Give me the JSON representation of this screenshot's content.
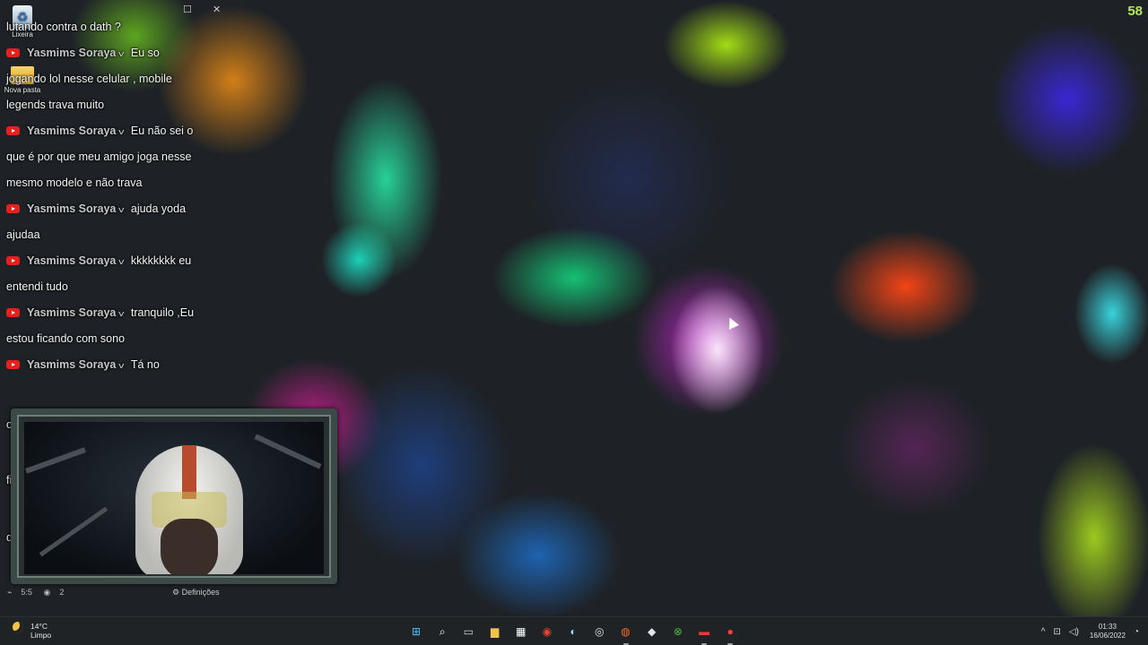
{
  "desktop": {
    "fps_counter": "58",
    "icons": [
      {
        "label": "Lixeira",
        "icon": "recycle-bin-icon"
      },
      {
        "label": "Nova pasta",
        "icon": "folder-icon"
      }
    ],
    "window_controls": {
      "maximize": "☐",
      "close": "✕"
    }
  },
  "chat": {
    "author": "Yasmims Soraya",
    "lines": [
      {
        "type": "text",
        "text": "lutando contra o dath ?"
      },
      {
        "type": "header",
        "message": "Eu so"
      },
      {
        "type": "text",
        "text": "jogando lol nesse celular , mobile"
      },
      {
        "type": "text",
        "text": "legends trava muito"
      },
      {
        "type": "header",
        "message": "Eu não sei o"
      },
      {
        "type": "text",
        "text": "que é por que meu amigo joga nesse"
      },
      {
        "type": "text",
        "text": "mesmo modelo e não trava"
      },
      {
        "type": "header",
        "message": "ajuda yoda"
      },
      {
        "type": "text",
        "text": "ajudaa"
      },
      {
        "type": "header",
        "message": "kkkkkkkk eu"
      },
      {
        "type": "text",
        "text": "entendi tudo"
      },
      {
        "type": "header",
        "message": "tranquilo ,Eu"
      },
      {
        "type": "text",
        "text": "estou ficando com sono"
      },
      {
        "type": "header",
        "message": "Tá no"
      }
    ],
    "clipped_lines": [
      "c",
      "fi",
      "d"
    ]
  },
  "stream_overlay": {
    "stats_left": "5:5",
    "viewers": "2",
    "settings_label": "Definições"
  },
  "taskbar": {
    "weather_temp": "14°C",
    "weather_desc": "Limpo",
    "apps": [
      {
        "name": "windows-start-icon",
        "glyph": "⊞",
        "color": "#4cc2ff"
      },
      {
        "name": "search-icon",
        "glyph": "⌕",
        "color": "#ffffff"
      },
      {
        "name": "task-view-icon",
        "glyph": "▭",
        "color": "#cfcfcf"
      },
      {
        "name": "file-explorer-icon",
        "glyph": "▆",
        "color": "#f2c14e"
      },
      {
        "name": "microsoft-store-icon",
        "glyph": "▦",
        "color": "#ffffff"
      },
      {
        "name": "chrome-icon",
        "glyph": "◉",
        "color": "#ea4335"
      },
      {
        "name": "steam-icon",
        "glyph": "◐",
        "color": "#9fd3ff"
      },
      {
        "name": "obs-icon",
        "glyph": "◎",
        "color": "#e0e0e0"
      },
      {
        "name": "origin-icon",
        "glyph": "◍",
        "color": "#f36d21"
      },
      {
        "name": "epic-icon",
        "glyph": "◆",
        "color": "#dfe6ee"
      },
      {
        "name": "xbox-icon",
        "glyph": "⊗",
        "color": "#53b848"
      },
      {
        "name": "streamlabs-icon",
        "glyph": "▬",
        "color": "#e23b3b"
      },
      {
        "name": "ea-app-icon",
        "glyph": "●",
        "color": "#ff3b3b"
      }
    ],
    "clock_time": "01:33",
    "clock_date": "16/06/2022",
    "tray": {
      "chevron": "^",
      "network": "⊡",
      "volume": "◁)"
    }
  }
}
